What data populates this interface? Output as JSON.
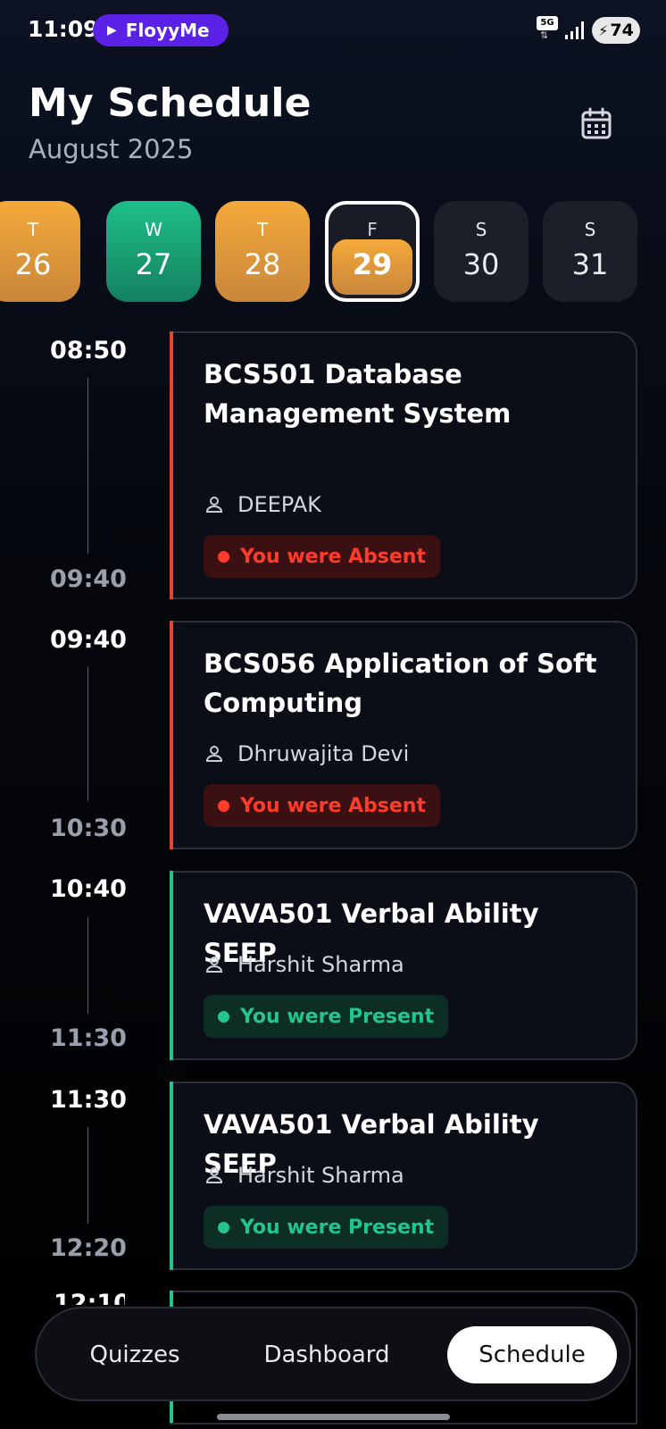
{
  "status_bar": {
    "time": "11:09",
    "media_label": "FloyyMe",
    "network": "5G",
    "battery": "74"
  },
  "header": {
    "title": "My Schedule",
    "subtitle": "August 2025"
  },
  "days": [
    {
      "dow": "T",
      "num": "26",
      "state": "orange"
    },
    {
      "dow": "W",
      "num": "27",
      "state": "green"
    },
    {
      "dow": "T",
      "num": "28",
      "state": "orange"
    },
    {
      "dow": "F",
      "num": "29",
      "state": "selected"
    },
    {
      "dow": "S",
      "num": "30",
      "state": "none"
    },
    {
      "dow": "S",
      "num": "31",
      "state": "none"
    }
  ],
  "classes": [
    {
      "start": "08:50",
      "end": "09:40",
      "title": "BCS501 Database Management System",
      "teacher": "DEEPAK",
      "status": "You were Absent",
      "status_type": "absent"
    },
    {
      "start": "09:40",
      "end": "10:30",
      "title": "BCS056 Application of Soft Computing",
      "teacher": "Dhruwajita Devi",
      "status": "You were Absent",
      "status_type": "absent"
    },
    {
      "start": "10:40",
      "end": "11:30",
      "title": "VAVA501 Verbal Ability SEEP",
      "teacher": "Harshit Sharma",
      "status": "You were Present",
      "status_type": "present"
    },
    {
      "start": "11:30",
      "end": "12:20",
      "title": "VAVA501 Verbal Ability SEEP",
      "teacher": "Harshit Sharma",
      "status": "You were Present",
      "status_type": "present"
    }
  ],
  "peek_time": "12:10",
  "nav": {
    "quizzes": "Quizzes",
    "dashboard": "Dashboard",
    "schedule": "Schedule"
  },
  "colors": {
    "orange": "#f4a93a",
    "green": "#1fbf8a",
    "absent": "#ff3b2a",
    "present": "#25c48c"
  }
}
